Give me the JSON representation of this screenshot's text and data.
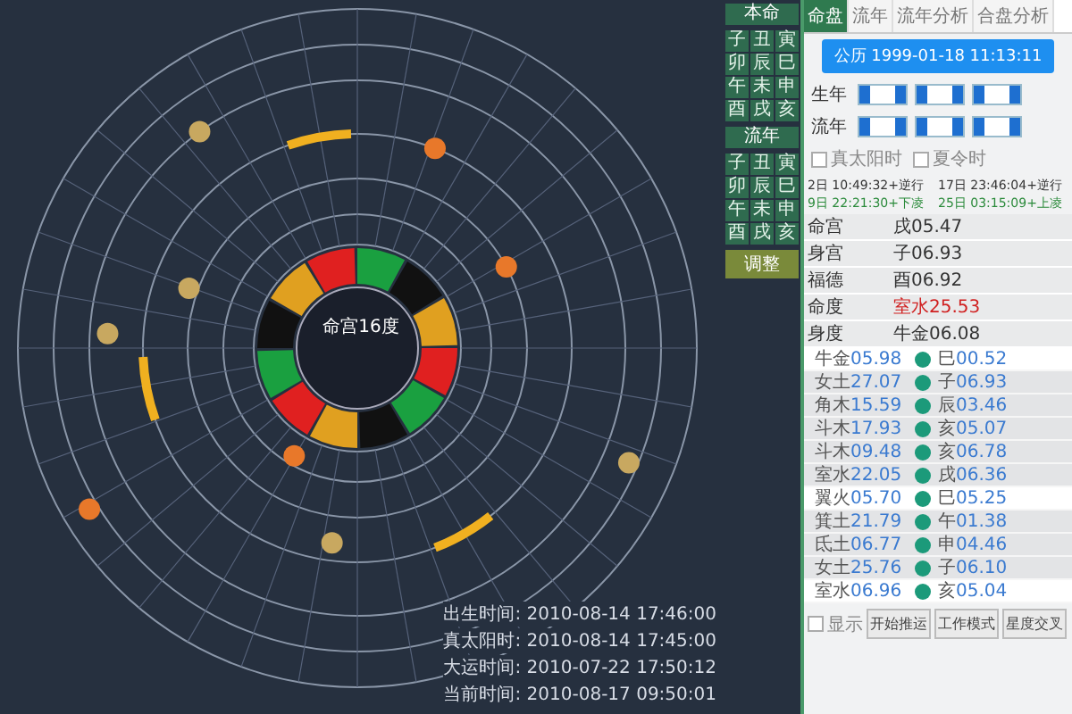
{
  "wheel": {
    "center_label": "命宫16度",
    "ring": [
      {
        "kind": "red"
      },
      {
        "kind": "green"
      },
      {
        "kind": "black"
      },
      {
        "kind": "yellow"
      },
      {
        "kind": "red"
      },
      {
        "kind": "green"
      },
      {
        "kind": "black"
      },
      {
        "kind": "yellow"
      },
      {
        "kind": "red"
      },
      {
        "kind": "green"
      },
      {
        "kind": "black"
      },
      {
        "kind": "yellow"
      }
    ],
    "times": [
      {
        "label": "出生时间:",
        "value": "2010-08-14 17:46:00"
      },
      {
        "label": "真太阳时:",
        "value": "2010-08-14 17:45:00"
      },
      {
        "label": "大运时间:",
        "value": "2010-07-22 17:50:12"
      },
      {
        "label": "当前时间:",
        "value": "2010-08-17 09:50:01"
      }
    ]
  },
  "mini_panel": {
    "sections": [
      {
        "title": "本命",
        "cells": [
          "子",
          "丑",
          "寅",
          "卯",
          "辰",
          "巳",
          "午",
          "未",
          "申",
          "酉",
          "戌",
          "亥"
        ]
      },
      {
        "title": "流年",
        "cells": [
          "子",
          "丑",
          "寅",
          "卯",
          "辰",
          "巳",
          "午",
          "未",
          "申",
          "酉",
          "戌",
          "亥"
        ]
      }
    ],
    "button": "调整"
  },
  "tabs": [
    {
      "label": "命盘",
      "selected": true
    },
    {
      "label": "流年",
      "selected": false
    },
    {
      "label": "流年分析",
      "selected": false
    },
    {
      "label": "合盘分析",
      "selected": false
    }
  ],
  "date_button": "公历 1999-01-18 11:13:11",
  "year_rows": [
    {
      "label": "生年"
    },
    {
      "label": "流年"
    }
  ],
  "options": [
    {
      "label": "真太阳时",
      "checked": false
    },
    {
      "label": "夏令时",
      "checked": false
    }
  ],
  "transits": [
    {
      "text": "2日 10:49:32+逆行",
      "kind": "plain"
    },
    {
      "text": "17日 23:46:04+逆行",
      "kind": "plain"
    },
    {
      "text": "9日 22:21:30+下凌",
      "kind": "green"
    },
    {
      "text": "25日 03:15:09+上凌",
      "kind": "green"
    }
  ],
  "info": [
    {
      "label": "命宫",
      "value": "戌05.47",
      "kind": "plain"
    },
    {
      "label": "身宫",
      "value": "子06.93",
      "kind": "plain"
    },
    {
      "label": "福德",
      "value": "酉06.92",
      "kind": "plain"
    },
    {
      "label": "命度",
      "value": "室水25.53",
      "kind": "red"
    },
    {
      "label": "身度",
      "value": "牛金06.08",
      "kind": "plain"
    }
  ],
  "planets": [
    {
      "star": "牛金",
      "degree": "05.98",
      "palace": "巳",
      "pdeg": "00.52",
      "selected": true
    },
    {
      "star": "女土",
      "degree": "27.07",
      "palace": "子",
      "pdeg": "06.93",
      "selected": false
    },
    {
      "star": "角木",
      "degree": "15.59",
      "palace": "辰",
      "pdeg": "03.46",
      "selected": false
    },
    {
      "star": "斗木",
      "degree": "17.93",
      "palace": "亥",
      "pdeg": "05.07",
      "selected": false
    },
    {
      "star": "斗木",
      "degree": "09.48",
      "palace": "亥",
      "pdeg": "06.78",
      "selected": false
    },
    {
      "star": "室水",
      "degree": "22.05",
      "palace": "戌",
      "pdeg": "06.36",
      "selected": false
    },
    {
      "star": "翼火",
      "degree": "05.70",
      "palace": "巳",
      "pdeg": "05.25",
      "selected": true
    },
    {
      "star": "箕土",
      "degree": "21.79",
      "palace": "午",
      "pdeg": "01.38",
      "selected": false
    },
    {
      "star": "氐土",
      "degree": "06.77",
      "palace": "申",
      "pdeg": "04.46",
      "selected": false
    },
    {
      "star": "女土",
      "degree": "25.76",
      "palace": "子",
      "pdeg": "06.10",
      "selected": false
    },
    {
      "star": "室水",
      "degree": "06.96",
      "palace": "亥",
      "pdeg": "05.04",
      "selected": true
    }
  ],
  "footer": {
    "check": {
      "label": "显示",
      "checked": false
    },
    "buttons": [
      "开始推运",
      "工作模式",
      "星度交叉"
    ]
  }
}
